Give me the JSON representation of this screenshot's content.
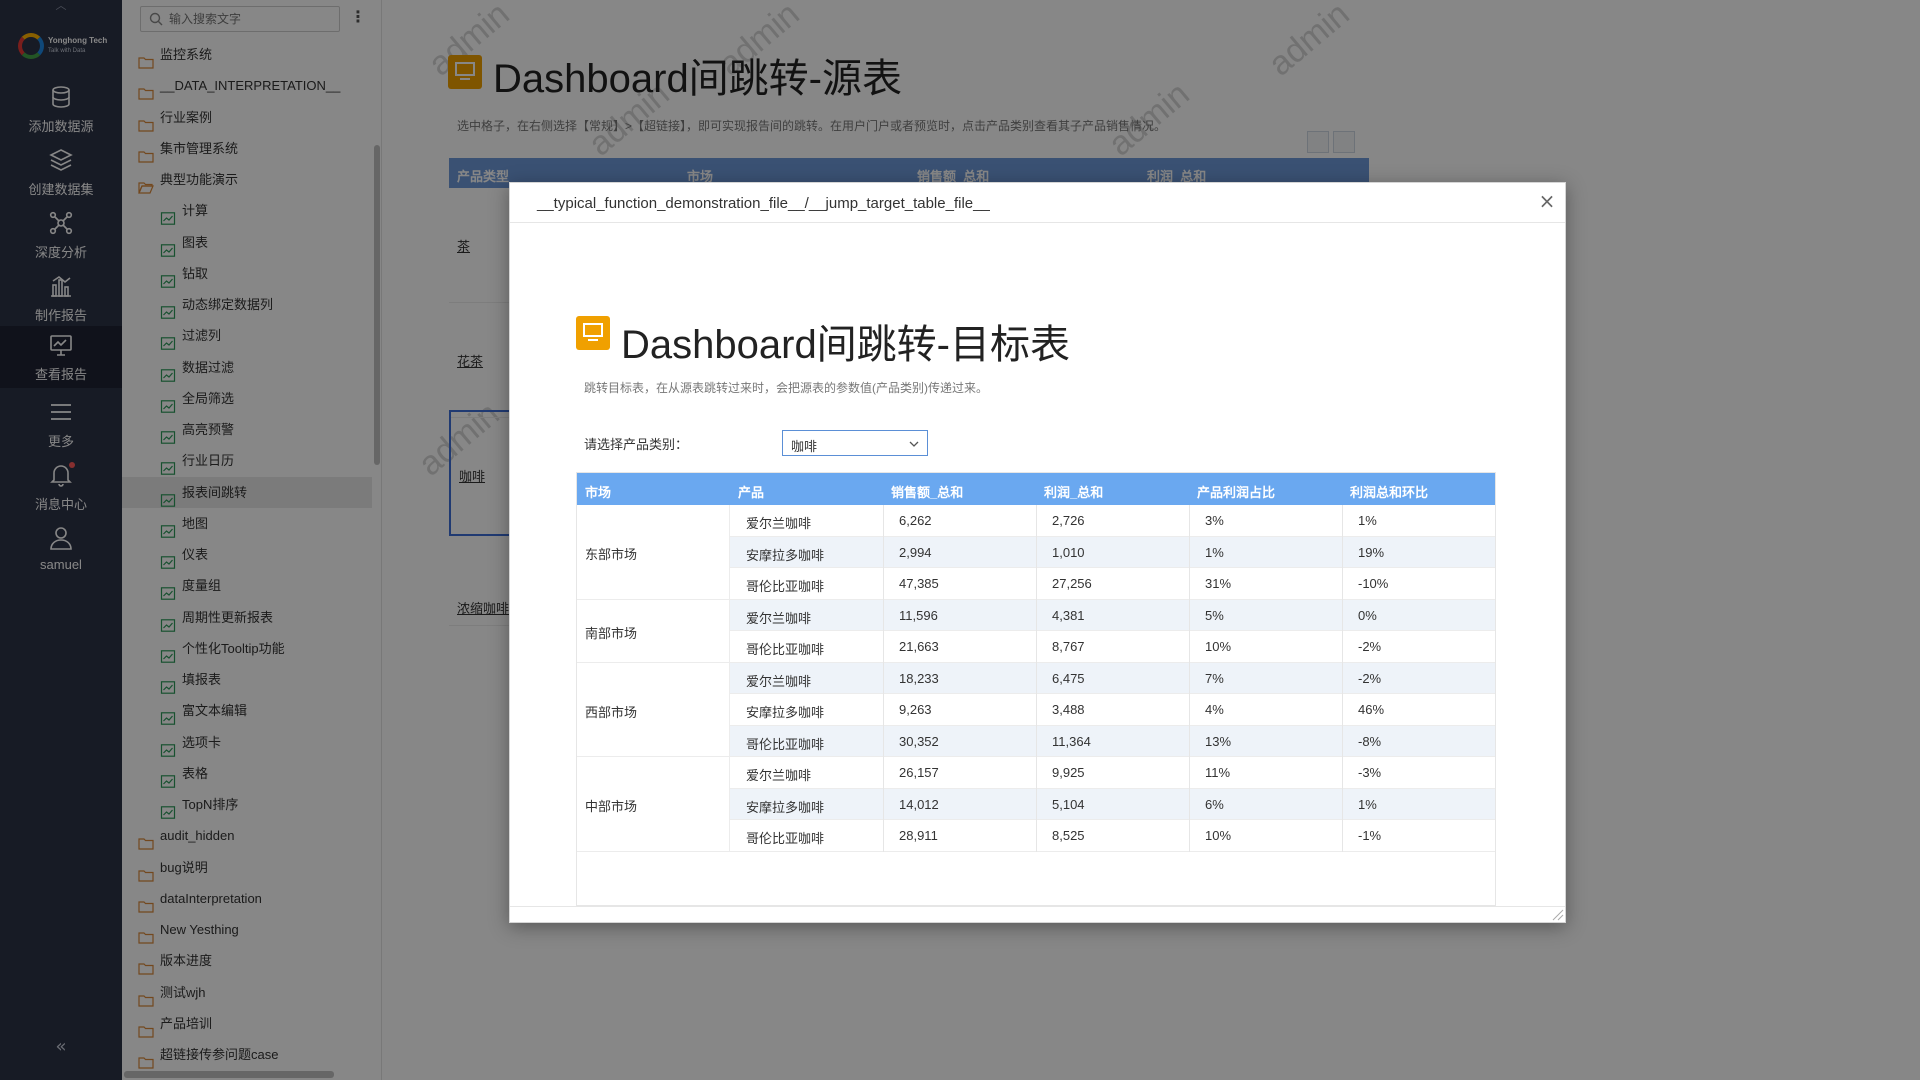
{
  "nav": {
    "logo_line1": "Yonghong Tech",
    "logo_line2": "Talk with Data",
    "items": [
      {
        "label": "添加数据源",
        "icon": "database-icon"
      },
      {
        "label": "创建数据集",
        "icon": "layers-icon"
      },
      {
        "label": "深度分析",
        "icon": "network-icon"
      },
      {
        "label": "制作报告",
        "icon": "bar-chart-icon"
      },
      {
        "label": "查看报告",
        "icon": "monitor-chart-icon"
      },
      {
        "label": "更多",
        "icon": "menu-icon"
      },
      {
        "label": "消息中心",
        "icon": "bell-icon"
      },
      {
        "label": "samuel",
        "icon": "user-icon"
      }
    ],
    "active_index": 4
  },
  "sidebar": {
    "search_placeholder": "输入搜索文字",
    "items": [
      {
        "label": "监控系统",
        "type": "folder",
        "level": 0
      },
      {
        "label": "__DATA_INTERPRETATION__",
        "type": "folder",
        "level": 0
      },
      {
        "label": "行业案例",
        "type": "folder",
        "level": 0
      },
      {
        "label": "集市管理系统",
        "type": "folder",
        "level": 0
      },
      {
        "label": "典型功能演示",
        "type": "folder-open",
        "level": 0
      },
      {
        "label": "计算",
        "type": "report",
        "level": 1
      },
      {
        "label": "图表",
        "type": "report",
        "level": 1
      },
      {
        "label": "钻取",
        "type": "report",
        "level": 1
      },
      {
        "label": "动态绑定数据列",
        "type": "report",
        "level": 1
      },
      {
        "label": "过滤列",
        "type": "report",
        "level": 1
      },
      {
        "label": "数据过滤",
        "type": "report",
        "level": 1
      },
      {
        "label": "全局筛选",
        "type": "report",
        "level": 1
      },
      {
        "label": "高亮预警",
        "type": "report",
        "level": 1
      },
      {
        "label": "行业日历",
        "type": "report",
        "level": 1
      },
      {
        "label": "报表间跳转",
        "type": "report",
        "level": 1,
        "selected": true
      },
      {
        "label": "地图",
        "type": "report",
        "level": 1
      },
      {
        "label": "仪表",
        "type": "report",
        "level": 1
      },
      {
        "label": "度量组",
        "type": "report",
        "level": 1
      },
      {
        "label": "周期性更新报表",
        "type": "report",
        "level": 1
      },
      {
        "label": "个性化Tooltip功能",
        "type": "report",
        "level": 1
      },
      {
        "label": "填报表",
        "type": "report",
        "level": 1
      },
      {
        "label": "富文本编辑",
        "type": "report",
        "level": 1
      },
      {
        "label": "选项卡",
        "type": "report",
        "level": 1
      },
      {
        "label": "表格",
        "type": "report",
        "level": 1
      },
      {
        "label": "TopN排序",
        "type": "report",
        "level": 1
      },
      {
        "label": "audit_hidden",
        "type": "folder",
        "level": 0
      },
      {
        "label": "bug说明",
        "type": "folder",
        "level": 0
      },
      {
        "label": "dataInterpretation",
        "type": "folder",
        "level": 0
      },
      {
        "label": "New Yesthing",
        "type": "folder",
        "level": 0
      },
      {
        "label": "版本进度",
        "type": "folder",
        "level": 0
      },
      {
        "label": "测试wjh",
        "type": "folder",
        "level": 0
      },
      {
        "label": "产品培训",
        "type": "folder",
        "level": 0
      },
      {
        "label": "超链接传参问题case",
        "type": "folder",
        "level": 0
      }
    ]
  },
  "source_report": {
    "title": "Dashboard间跳转-源表",
    "description": "选中格子，在右侧选择【常规】>【超链接】，即可实现报告间的跳转。在用户门户或者预览时，点击产品类别查看其子产品销售情况。",
    "watermark": "admin",
    "headers": [
      "产品类型",
      "市场",
      "销售额_总和",
      "利润_总和"
    ],
    "categories": [
      "茶",
      "花茶",
      "咖啡",
      "浓缩咖啡"
    ]
  },
  "modal": {
    "path": "__typical_function_demonstration_file__/__jump_target_table_file__",
    "title": "Dashboard间跳转-目标表",
    "description": "跳转目标表，在从源表跳转过来时，会把源表的参数值(产品类别)传递过来。",
    "filter_label": "请选择产品类别：",
    "filter_value": "咖啡",
    "table": {
      "headers": [
        "市场",
        "产品",
        "销售额_总和",
        "利润_总和",
        "产品利润占比",
        "利润总和环比"
      ],
      "groups": [
        {
          "market": "东部市场",
          "rows": [
            [
              "爱尔兰咖啡",
              "6,262",
              "2,726",
              "3%",
              "1%"
            ],
            [
              "安摩拉多咖啡",
              "2,994",
              "1,010",
              "1%",
              "19%"
            ],
            [
              "哥伦比亚咖啡",
              "47,385",
              "27,256",
              "31%",
              "-10%"
            ]
          ]
        },
        {
          "market": "南部市场",
          "rows": [
            [
              "爱尔兰咖啡",
              "11,596",
              "4,381",
              "5%",
              "0%"
            ],
            [
              "哥伦比亚咖啡",
              "21,663",
              "8,767",
              "10%",
              "-2%"
            ]
          ]
        },
        {
          "market": "西部市场",
          "rows": [
            [
              "爱尔兰咖啡",
              "18,233",
              "6,475",
              "7%",
              "-2%"
            ],
            [
              "安摩拉多咖啡",
              "9,263",
              "3,488",
              "4%",
              "46%"
            ],
            [
              "哥伦比亚咖啡",
              "30,352",
              "11,364",
              "13%",
              "-8%"
            ]
          ]
        },
        {
          "market": "中部市场",
          "rows": [
            [
              "爱尔兰咖啡",
              "26,157",
              "9,925",
              "11%",
              "-3%"
            ],
            [
              "安摩拉多咖啡",
              "14,012",
              "5,104",
              "6%",
              "1%"
            ],
            [
              "哥伦比亚咖啡",
              "28,911",
              "8,525",
              "10%",
              "-1%"
            ]
          ]
        }
      ]
    }
  },
  "colors": {
    "nav_bg": "#2d3346",
    "accent_orange": "#f0a000",
    "table_header_blue": "#6aa8f0",
    "select_border": "#5b8fd6"
  }
}
